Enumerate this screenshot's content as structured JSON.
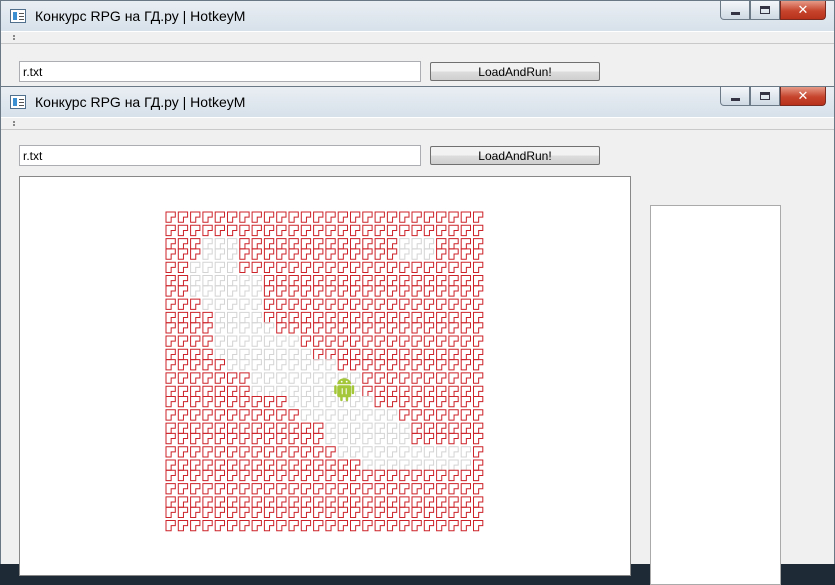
{
  "windows": [
    {
      "title": "Конкурс RPG на ГД.ру | HotkeyM",
      "file_input": "r.txt",
      "run_button": "LoadAndRun!"
    },
    {
      "title": "Конкурс RPG на ГД.ру | HotkeyM",
      "file_input": "r.txt",
      "run_button": "LoadAndRun!"
    }
  ],
  "caption_buttons": {
    "minimize": "–",
    "maximize": "□",
    "close": "✕"
  },
  "game_map": {
    "cols": 26,
    "rows": 26,
    "wall_color": "#cc2229",
    "floor_color": "#d4d4d4",
    "player": {
      "row": 14,
      "col": 14,
      "icon": "android-robot-icon",
      "color": "#a4c639"
    },
    "grid": [
      "WWWWWWWWWWWWWWWWWWWWWWWWWW",
      "WWWWWWWWWWWWWWWWWWWWWWWWWW",
      "WWWFFFWWWWWWWWWWWWWFFFWWWW",
      "WWWFFFWWWWWWWWWWWWWFFFWWWW",
      "WWFFFFWWWWWWWWWWWWWWWWWWWW",
      "WWFFFFFFWWWWWWWWWWWWWWWWWW",
      "WWFFFFFFWWWWWWWWWWWWWWWWWW",
      "WWWFFFFFWWWWWWWWWWWWWWWWWW",
      "WWWWFFFFWWWWWWWWWWWWWWWWWW",
      "WWWWFFFFFWWWWWWWWWWWWWWWWW",
      "WWWWFFFFFFFWWWWWWWWWWWWWWW",
      "WWWWFFFFFFFFWWWWWWWWWWWWWW",
      "WWWWWFFFFFFFFFWWWWWWWWWWWW",
      "WWWWWWWFFFFFFFFFWWWWWWWWWW",
      "WWWWWWWFFFFFFFFFWWWWWWWWWW",
      "WWWWWWWWWWFFFFFFFWWWWWWWWW",
      "WWWWWWWWWWWFFFFFFFFWWWWWWW",
      "WWWWWWWWWWWWWFFFFFFFWWWWWW",
      "WWWWWWWWWWWWWFFFFFFFWWWWWW",
      "WWWWWWWWWWWWWWFFFFFFFFFFFW",
      "WWWWWWWWWWWWWWWWFFFFFFFFFW",
      "WWWWWWWWWWWWWWWWWWWWWWWWWW",
      "WWWWWWWWWWWWWWWWWWWWWWWWWW",
      "WWWWWWWWWWWWWWWWWWWWWWWWWW",
      "WWWWWWWWWWWWWWWWWWWWWWWWWW",
      "WWWWWWWWWWWWWWWWWWWWWWWWWW"
    ]
  }
}
